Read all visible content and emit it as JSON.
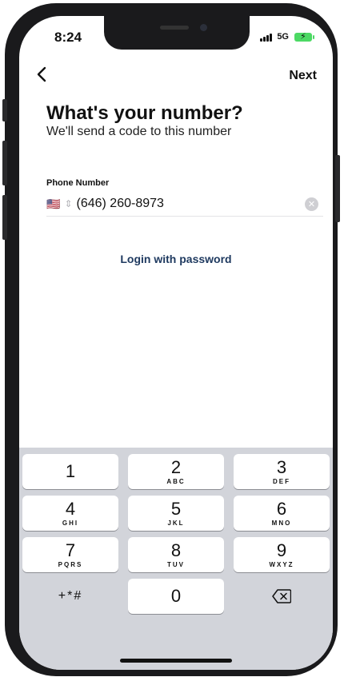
{
  "status": {
    "time": "8:24",
    "network": "5G"
  },
  "nav": {
    "next_label": "Next"
  },
  "header": {
    "title": "What's your number?",
    "subtitle": "We'll send a code to this number"
  },
  "phone": {
    "label": "Phone Number",
    "flag": "🇺🇸",
    "value": "(646) 260-8973"
  },
  "login_link": "Login with password",
  "keypad": {
    "keys": [
      {
        "digit": "1",
        "letters": ""
      },
      {
        "digit": "2",
        "letters": "ABC"
      },
      {
        "digit": "3",
        "letters": "DEF"
      },
      {
        "digit": "4",
        "letters": "GHI"
      },
      {
        "digit": "5",
        "letters": "JKL"
      },
      {
        "digit": "6",
        "letters": "MNO"
      },
      {
        "digit": "7",
        "letters": "PQRS"
      },
      {
        "digit": "8",
        "letters": "TUV"
      },
      {
        "digit": "9",
        "letters": "WXYZ"
      },
      {
        "digit": "+*#",
        "letters": ""
      },
      {
        "digit": "0",
        "letters": ""
      }
    ]
  },
  "colors": {
    "link": "#1f3a60",
    "keyboard_bg": "#d2d4da",
    "battery": "#4cd964"
  }
}
